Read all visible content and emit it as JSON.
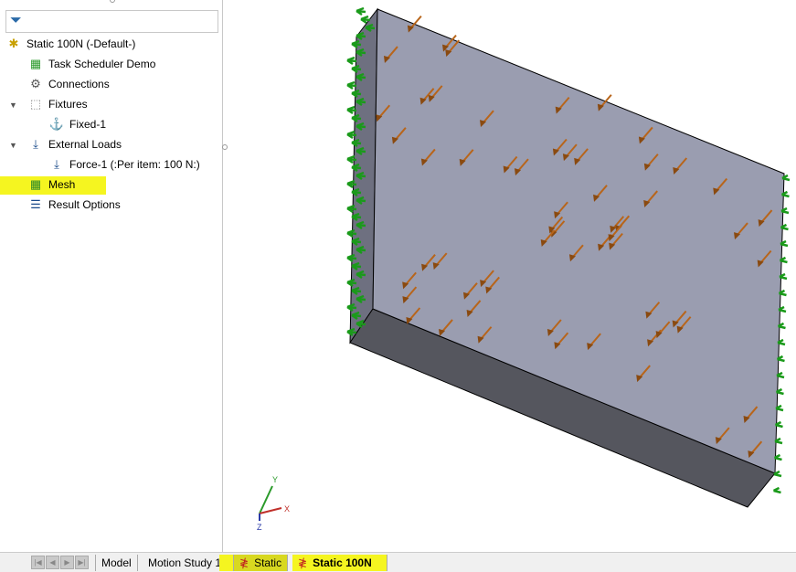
{
  "tree": {
    "filter_icon": "funnel-icon",
    "root": "Static 100N (-Default-)",
    "items": [
      {
        "label": "Task Scheduler Demo",
        "icon": "part-icon"
      },
      {
        "label": "Connections",
        "icon": "bolt-icon"
      },
      {
        "label": "Fixtures",
        "icon": "fixtures-icon",
        "expanded": true
      },
      {
        "label": "Fixed-1",
        "icon": "anchor-icon"
      },
      {
        "label": "External Loads",
        "icon": "external-loads-icon",
        "expanded": true
      },
      {
        "label": "Force-1 (:Per item: 100 N:)",
        "icon": "force-arrow-icon"
      },
      {
        "label": "Mesh",
        "icon": "mesh-icon",
        "highlighted": true
      },
      {
        "label": "Result Options",
        "icon": "list-icon"
      }
    ]
  },
  "triad": {
    "x": "X",
    "y": "Y",
    "z": "Z"
  },
  "tabs": [
    {
      "label": "Model"
    },
    {
      "label": "Motion Study 1"
    },
    {
      "label": "Static",
      "highlighted": true
    },
    {
      "label": "Static 100N",
      "active": true,
      "highlighted": true
    }
  ],
  "colors": {
    "highlight": "#f5f520",
    "plate": "#9a9db0",
    "plate_dark": "#55565e",
    "fixture": "#1a9a1a",
    "force": "#b8651a"
  }
}
